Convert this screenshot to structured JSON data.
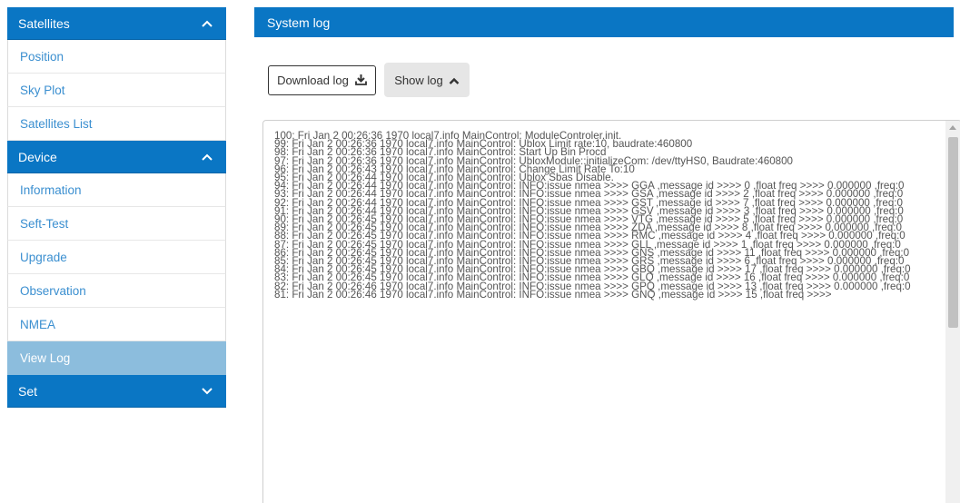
{
  "sidebar": {
    "sections": [
      {
        "title": "Satellites",
        "expanded": true,
        "items": [
          "Position",
          "Sky Plot",
          "Satellites List"
        ]
      },
      {
        "title": "Device",
        "expanded": true,
        "items": [
          "Information",
          "Seft-Test",
          "Upgrade",
          "Observation",
          "NMEA",
          "View Log"
        ]
      },
      {
        "title": "Set",
        "expanded": false,
        "items": []
      }
    ],
    "active_item": "View Log"
  },
  "main": {
    "title": "System log",
    "download_label": "Download log",
    "show_label": "Show log",
    "log_lines": [
      "100: Fri Jan 2 00:26:36 1970 local7.info MainControl: ModuleControler.init.",
      "99: Fri Jan 2 00:26:36 1970 local7.info MainControl: Ublox Limit rate:10, baudrate:460800",
      "98: Fri Jan 2 00:26:36 1970 local7.info MainControl: Start Up Bin Procd",
      "97: Fri Jan 2 00:26:36 1970 local7.info MainControl: UbloxModule::initializeCom: /dev/ttyHS0, Baudrate:460800",
      "96: Fri Jan 2 00:26:43 1970 local7.info MainControl: Change Limit Rate To:10",
      "95: Fri Jan 2 00:26:44 1970 local7.info MainControl: Ublox Sbas Disable.",
      "94: Fri Jan 2 00:26:44 1970 local7.info MainControl: INFO:issue nmea >>>> GGA ,message id >>>> 0 ,float freq >>>> 0.000000 ,freq:0",
      "93: Fri Jan 2 00:26:44 1970 local7.info MainControl: INFO:issue nmea >>>> GSA ,message id >>>> 2 ,float freq >>>> 0.000000 ,freq:0",
      "92: Fri Jan 2 00:26:44 1970 local7.info MainControl: INFO:issue nmea >>>> GST ,message id >>>> 7 ,float freq >>>> 0.000000 ,freq:0",
      "91: Fri Jan 2 00:26:44 1970 local7.info MainControl: INFO:issue nmea >>>> GSV ,message id >>>> 3 ,float freq >>>> 0.000000 ,freq:0",
      "90: Fri Jan 2 00:26:45 1970 local7.info MainControl: INFO:issue nmea >>>> VTG ,message id >>>> 5 ,float freq >>>> 0.000000 ,freq:0",
      "89: Fri Jan 2 00:26:45 1970 local7.info MainControl: INFO:issue nmea >>>> ZDA ,message id >>>> 8 ,float freq >>>> 0.000000 ,freq:0",
      "88: Fri Jan 2 00:26:45 1970 local7.info MainControl: INFO:issue nmea >>>> RMC ,message id >>>> 4 ,float freq >>>> 0.000000 ,freq:0",
      "87: Fri Jan 2 00:26:45 1970 local7.info MainControl: INFO:issue nmea >>>> GLL ,message id >>>> 1 ,float freq >>>> 0.000000 ,freq:0",
      "86: Fri Jan 2 00:26:45 1970 local7.info MainControl: INFO:issue nmea >>>> GNS ,message id >>>> 11 ,float freq >>>> 0.000000 ,freq:0",
      "85: Fri Jan 2 00:26:45 1970 local7.info MainControl: INFO:issue nmea >>>> GRS ,message id >>>> 6 ,float freq >>>> 0.000000 ,freq:0",
      "84: Fri Jan 2 00:26:45 1970 local7.info MainControl: INFO:issue nmea >>>> GBQ ,message id >>>> 17 ,float freq >>>> 0.000000 ,freq:0",
      "83: Fri Jan 2 00:26:45 1970 local7.info MainControl: INFO:issue nmea >>>> GLQ ,message id >>>> 16 ,float freq >>>> 0.000000 ,freq:0",
      "82: Fri Jan 2 00:26:46 1970 local7.info MainControl: INFO:issue nmea >>>> GPQ ,message id >>>> 13 ,float freq >>>> 0.000000 ,freq:0",
      "81: Fri Jan 2 00:26:46 1970 local7.info MainControl: INFO:issue nmea >>>> GNQ ,message id >>>> 15 ,float freq >>>>"
    ]
  },
  "icons": {
    "expand": "chevron-up-icon",
    "collapse": "chevron-down-icon",
    "download": "download-icon"
  },
  "colors": {
    "header_blue": "#0a76c4",
    "link_blue": "#3b8fd0",
    "active_bg": "#8cbddd"
  }
}
